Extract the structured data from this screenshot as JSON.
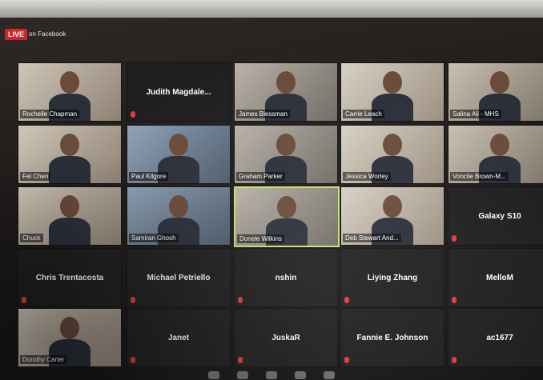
{
  "live": {
    "badge": "LIVE",
    "text": "on Facebook"
  },
  "participants": [
    {
      "name": "Rochelle Chapman",
      "type": "video"
    },
    {
      "name": "Judith Magdale...",
      "type": "name"
    },
    {
      "name": "James Blessman",
      "type": "video"
    },
    {
      "name": "Carrie Leach",
      "type": "video"
    },
    {
      "name": "Salina Ali - MHS",
      "type": "video"
    },
    {
      "name": "Fei Chen",
      "type": "video"
    },
    {
      "name": "Paul Kilgore",
      "type": "video"
    },
    {
      "name": "Graham Parker",
      "type": "video"
    },
    {
      "name": "Jessica Worley",
      "type": "video"
    },
    {
      "name": "Voncile Brown-M...",
      "type": "video"
    },
    {
      "name": "Chuck",
      "type": "video"
    },
    {
      "name": "Samiran Ghosh",
      "type": "video"
    },
    {
      "name": "Donele Wilkins",
      "type": "video",
      "active": true
    },
    {
      "name": "Deb Stewart And...",
      "type": "video"
    },
    {
      "name": "Galaxy S10",
      "type": "name"
    },
    {
      "name": "Chris Trentacosta",
      "type": "name"
    },
    {
      "name": "Michael Petriello",
      "type": "name"
    },
    {
      "name": "nshin",
      "type": "name"
    },
    {
      "name": "Liying Zhang",
      "type": "name"
    },
    {
      "name": "MelloM",
      "type": "name"
    },
    {
      "name": "Dorothy Carter",
      "type": "video"
    },
    {
      "name": "Janet",
      "type": "name"
    },
    {
      "name": "JuskaR",
      "type": "name"
    },
    {
      "name": "Fannie E. Johnson",
      "type": "name"
    },
    {
      "name": "ac1677",
      "type": "name"
    }
  ],
  "colors": {
    "live": "#d0262a",
    "active_border": "#c7e26a",
    "muted_mic": "#e43a3a"
  }
}
